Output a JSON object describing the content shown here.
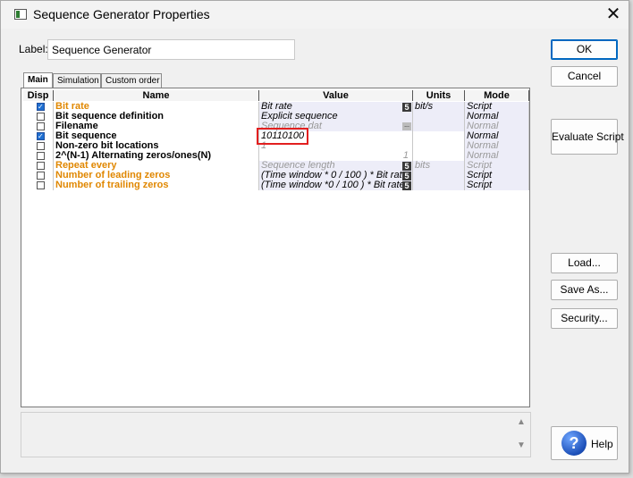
{
  "window": {
    "title": "Sequence Generator Properties",
    "close_glyph": "✕"
  },
  "label_field": {
    "caption": "Label:",
    "value": "Sequence Generator"
  },
  "tabs": [
    {
      "label": "Main",
      "active": true
    },
    {
      "label": "Simulation",
      "active": false
    },
    {
      "label": "Custom order",
      "active": false
    }
  ],
  "grid": {
    "headers": {
      "disp": "Disp",
      "name": "Name",
      "value": "Value",
      "units": "Units",
      "mode": "Mode"
    },
    "rows": [
      {
        "checked": true,
        "name": "Bit rate",
        "name_color": "orange",
        "value": "Bit rate",
        "value_gray": false,
        "value_button": "5",
        "units": "bit/s",
        "mode": "Script",
        "mode_gray": false
      },
      {
        "checked": false,
        "name": "Bit sequence definition",
        "name_color": "black",
        "value": "Explicit sequence",
        "value_gray": false,
        "value_button": "",
        "units": "",
        "mode": "Normal",
        "mode_gray": false
      },
      {
        "checked": false,
        "name": "Filename",
        "name_color": "black",
        "value": "Sequence.dat",
        "value_gray": true,
        "value_button": "...",
        "units": "",
        "mode": "Normal",
        "mode_gray": true
      },
      {
        "checked": true,
        "name": "Bit sequence",
        "name_color": "black",
        "value": "10110100",
        "value_gray": false,
        "value_button": "",
        "units": "",
        "mode": "Normal",
        "mode_gray": false
      },
      {
        "checked": false,
        "name": "Non-zero bit locations",
        "name_color": "black",
        "value": "1",
        "value_gray": true,
        "value_button": "",
        "units": "",
        "mode": "Normal",
        "mode_gray": true
      },
      {
        "checked": false,
        "name": "2^(N-1) Alternating zeros/ones(N)",
        "name_color": "black",
        "value": "1",
        "value_gray": true,
        "value_button": "",
        "units": "",
        "mode": "Normal",
        "mode_gray": true,
        "value_right": true
      },
      {
        "checked": false,
        "name": "Repeat every",
        "name_color": "orange",
        "value": "Sequence length",
        "value_gray": true,
        "value_button": "5",
        "units": "bits",
        "mode": "Script",
        "mode_gray": true
      },
      {
        "checked": false,
        "name": "Number of leading zeros",
        "name_color": "orange",
        "value": "(Time window * 0 / 100 ) * Bit rate",
        "value_gray": false,
        "value_button": "5",
        "units": "",
        "mode": "Script",
        "mode_gray": false
      },
      {
        "checked": false,
        "name": "Number of trailing zeros",
        "name_color": "orange",
        "value": "(Time window *0 / 100 ) * Bit rate",
        "value_gray": false,
        "value_button": "5",
        "units": "",
        "mode": "Script",
        "mode_gray": false
      }
    ]
  },
  "buttons": {
    "ok": "OK",
    "cancel": "Cancel",
    "evaluate": "Evaluate Script",
    "load": "Load...",
    "save_as": "Save As...",
    "security": "Security...",
    "help": "Help",
    "help_glyph": "?"
  },
  "colors": {
    "orange_text": "#e08700",
    "highlight": "#e21f1f",
    "accent": "#0067c0"
  }
}
